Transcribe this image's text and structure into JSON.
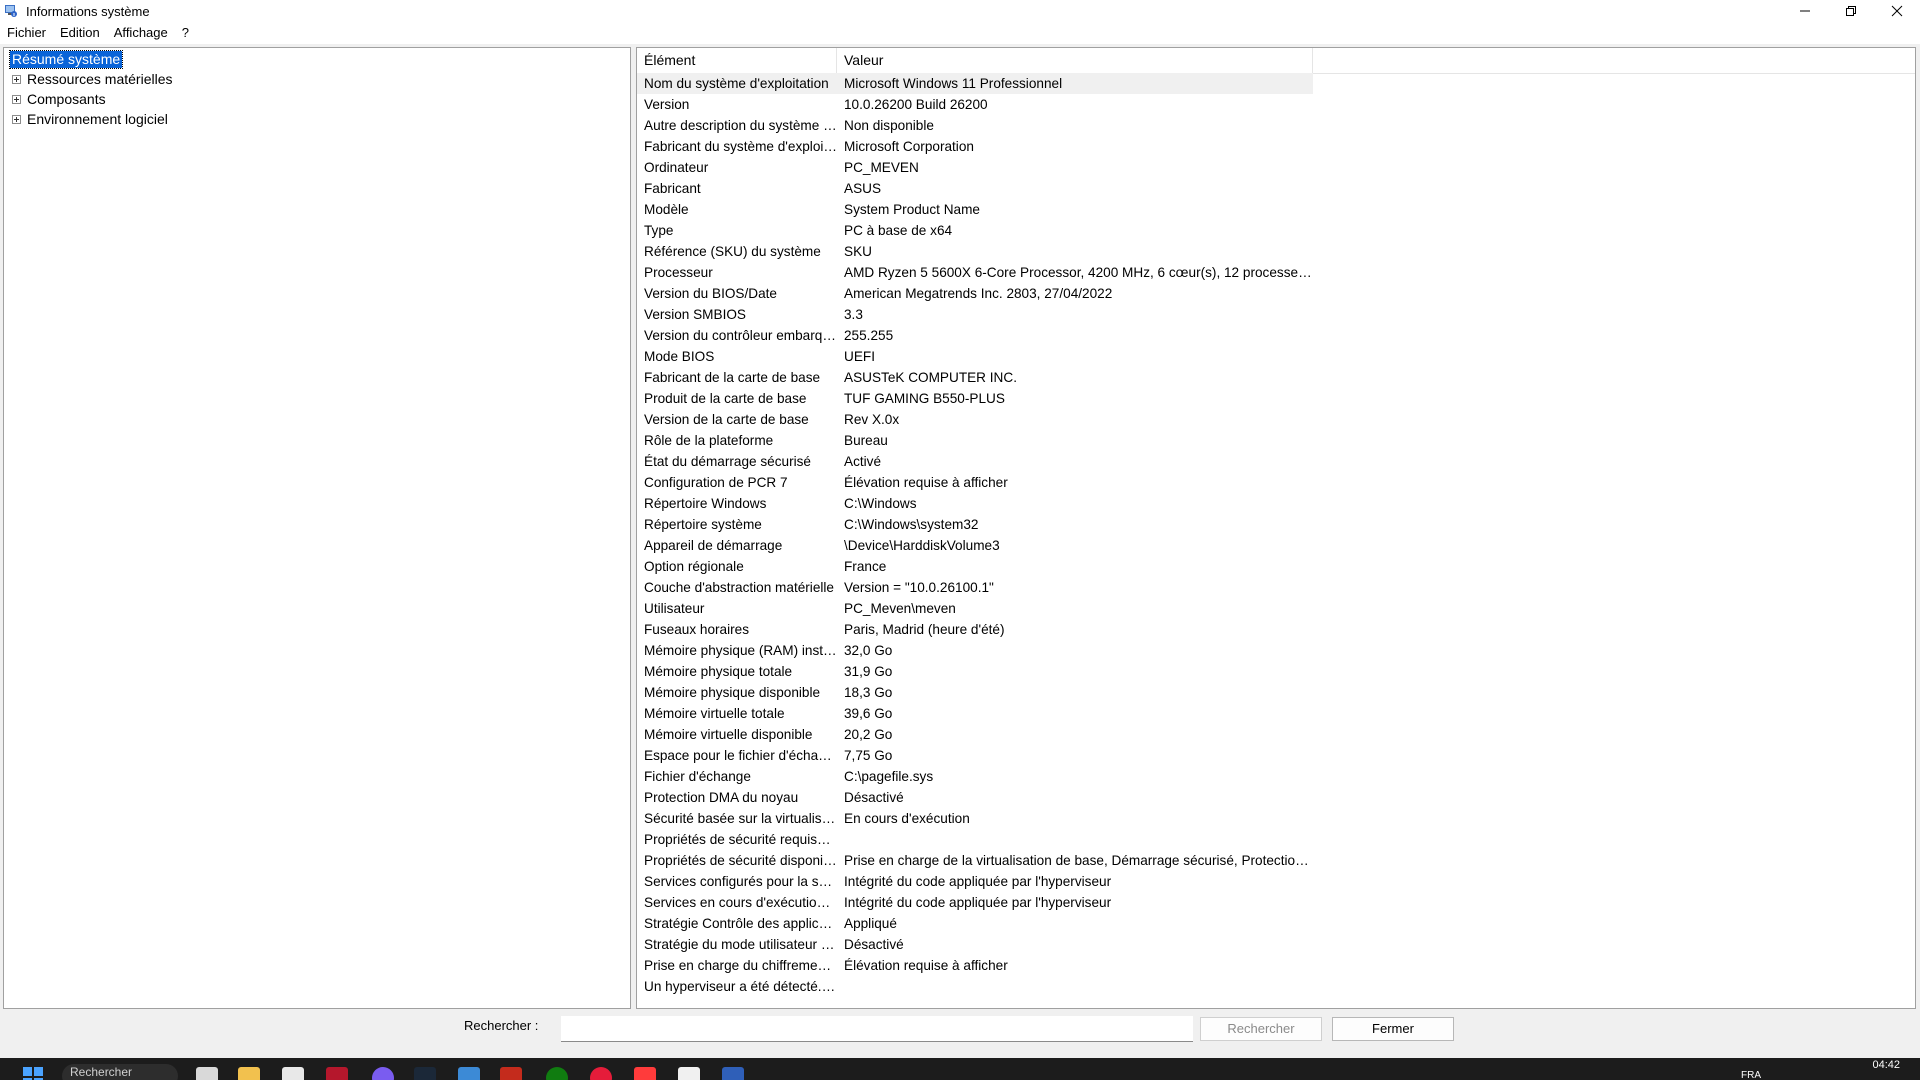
{
  "window": {
    "title": "Informations système",
    "controls": {
      "minimize": "minimize-icon",
      "maximize": "restore-icon",
      "close": "close-icon"
    }
  },
  "menu": [
    "Fichier",
    "Edition",
    "Affichage",
    "?"
  ],
  "tree": {
    "root": "Résumé système",
    "items": [
      "Ressources matérielles",
      "Composants",
      "Environnement logiciel"
    ]
  },
  "list": {
    "headers": {
      "element": "Élément",
      "value": "Valeur"
    },
    "rows": [
      {
        "element": "Nom du système d'exploitation",
        "value": "Microsoft Windows 11 Professionnel"
      },
      {
        "element": "Version",
        "value": "10.0.26200 Build 26200"
      },
      {
        "element": "Autre description du système d...",
        "value": "Non disponible"
      },
      {
        "element": "Fabricant du système d'exploit...",
        "value": "Microsoft Corporation"
      },
      {
        "element": "Ordinateur",
        "value": "PC_MEVEN"
      },
      {
        "element": "Fabricant",
        "value": "ASUS"
      },
      {
        "element": "Modèle",
        "value": "System Product Name"
      },
      {
        "element": "Type",
        "value": "PC à base de x64"
      },
      {
        "element": "Référence (SKU) du système",
        "value": "SKU"
      },
      {
        "element": "Processeur",
        "value": "AMD Ryzen 5 5600X 6-Core Processor, 4200 MHz, 6 cœur(s), 12 processeur(s..."
      },
      {
        "element": "Version du BIOS/Date",
        "value": "American Megatrends Inc. 2803, 27/04/2022"
      },
      {
        "element": "Version SMBIOS",
        "value": "3.3"
      },
      {
        "element": "Version du contrôleur embarqué",
        "value": "255.255"
      },
      {
        "element": "Mode BIOS",
        "value": "UEFI"
      },
      {
        "element": "Fabricant de la carte de base",
        "value": "ASUSTeK COMPUTER INC."
      },
      {
        "element": "Produit de la carte de base",
        "value": "TUF GAMING B550-PLUS"
      },
      {
        "element": "Version de la carte de base",
        "value": "Rev X.0x"
      },
      {
        "element": "Rôle de la plateforme",
        "value": "Bureau"
      },
      {
        "element": "État du démarrage sécurisé",
        "value": "Activé"
      },
      {
        "element": "Configuration de PCR 7",
        "value": "Élévation requise à afficher"
      },
      {
        "element": "Répertoire Windows",
        "value": "C:\\Windows"
      },
      {
        "element": "Répertoire système",
        "value": "C:\\Windows\\system32"
      },
      {
        "element": "Appareil de démarrage",
        "value": "\\Device\\HarddiskVolume3"
      },
      {
        "element": "Option régionale",
        "value": "France"
      },
      {
        "element": "Couche d'abstraction matérielle",
        "value": "Version = \"10.0.26100.1\""
      },
      {
        "element": "Utilisateur",
        "value": "PC_Meven\\meven"
      },
      {
        "element": "Fuseaux horaires",
        "value": "Paris, Madrid (heure d'été)"
      },
      {
        "element": "Mémoire physique (RAM) instal...",
        "value": "32,0 Go"
      },
      {
        "element": "Mémoire physique totale",
        "value": "31,9 Go"
      },
      {
        "element": "Mémoire physique disponible",
        "value": "18,3 Go"
      },
      {
        "element": "Mémoire virtuelle totale",
        "value": "39,6 Go"
      },
      {
        "element": "Mémoire virtuelle disponible",
        "value": "20,2 Go"
      },
      {
        "element": "Espace pour le fichier d'échange",
        "value": "7,75 Go"
      },
      {
        "element": "Fichier d'échange",
        "value": "C:\\pagefile.sys"
      },
      {
        "element": "Protection DMA du noyau",
        "value": "Désactivé"
      },
      {
        "element": "Sécurité basée sur la virtualisati...",
        "value": "En cours d'exécution"
      },
      {
        "element": "Propriétés de sécurité requises...",
        "value": ""
      },
      {
        "element": "Propriétés de sécurité disponib...",
        "value": "Prise en charge de la virtualisation de base, Démarrage sécurisé, Protection D..."
      },
      {
        "element": "Services configurés pour la séc...",
        "value": "Intégrité du code appliquée par l'hyperviseur"
      },
      {
        "element": "Services en cours d'exécution p...",
        "value": "Intégrité du code appliquée par l'hyperviseur"
      },
      {
        "element": "Stratégie Contrôle des applicat...",
        "value": "Appliqué"
      },
      {
        "element": "Stratégie du mode utilisateur d...",
        "value": "Désactivé"
      },
      {
        "element": "Prise en charge du chiffrement ...",
        "value": "Élévation requise à afficher"
      },
      {
        "element": "Un hyperviseur a été détecté. L...",
        "value": ""
      }
    ]
  },
  "search": {
    "label": "Rechercher :",
    "placeholder": "",
    "search_button": "Rechercher",
    "close_button": "Fermer"
  },
  "taskbar": {
    "search_text": "Rechercher",
    "language": "FRA",
    "time": "04:42",
    "colors": {
      "background": "#1c1c1c",
      "accent": "#0a64d8"
    }
  }
}
